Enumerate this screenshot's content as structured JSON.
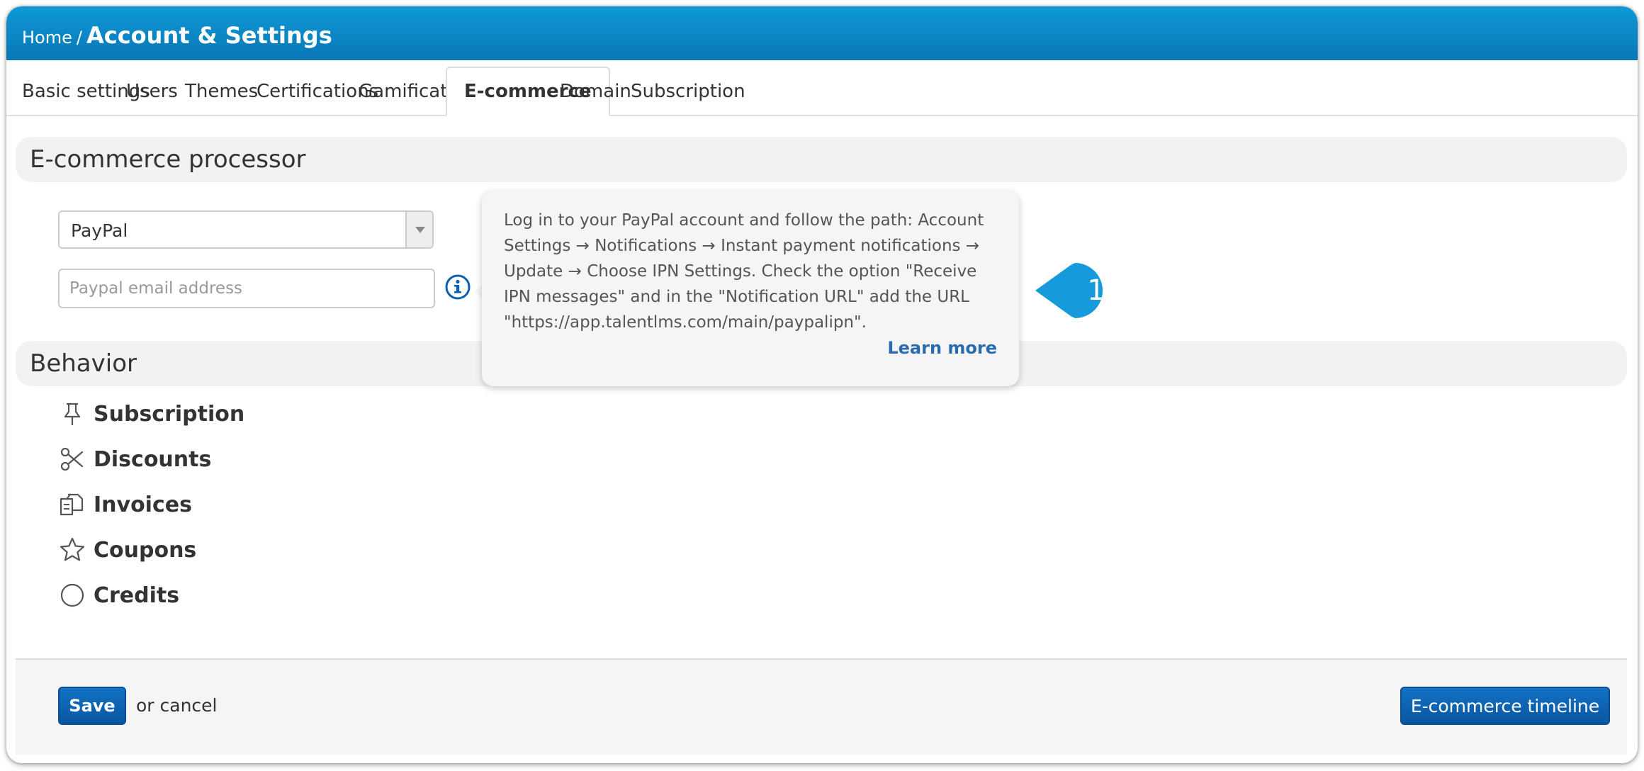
{
  "header": {
    "breadcrumb_home": "Home",
    "breadcrumb_separator": "/",
    "title": "Account & Settings"
  },
  "tabs": [
    {
      "label": "Basic settings",
      "active": false
    },
    {
      "label": "Users",
      "active": false
    },
    {
      "label": "Themes",
      "active": false
    },
    {
      "label": "Certifications",
      "active": false
    },
    {
      "label": "Gamification",
      "active": false
    },
    {
      "label": "E-commerce",
      "active": true
    },
    {
      "label": "Domain",
      "active": false
    },
    {
      "label": "Subscription",
      "active": false
    }
  ],
  "processor_section": {
    "title": "E-commerce processor",
    "select_value": "PayPal",
    "email_placeholder": "Paypal email address",
    "email_value": ""
  },
  "tooltip": {
    "text": "Log in to your PayPal account and follow the path: Account Settings → Notifications → Instant payment notifications → Update → Choose IPN Settings. Check the option \"Receive IPN messages\" and in the \"Notification URL\" add the URL \"https://app.talentlms.com/main/paypalipn\".",
    "link": "Learn more"
  },
  "callout": {
    "number": "1"
  },
  "behavior_section": {
    "title": "Behavior",
    "items": [
      {
        "label": "Subscription",
        "icon": "pin-icon"
      },
      {
        "label": "Discounts",
        "icon": "scissors-icon"
      },
      {
        "label": "Invoices",
        "icon": "documents-icon"
      },
      {
        "label": "Coupons",
        "icon": "star-icon"
      },
      {
        "label": "Credits",
        "icon": "circle-icon"
      }
    ]
  },
  "footer": {
    "save_label": "Save",
    "cancel_text": "or cancel",
    "timeline_label": "E-commerce timeline"
  },
  "colors": {
    "header": "#0a86c6",
    "primary_button": "#0a5fae",
    "link": "#2a6bb0",
    "callout": "#159bdc"
  }
}
